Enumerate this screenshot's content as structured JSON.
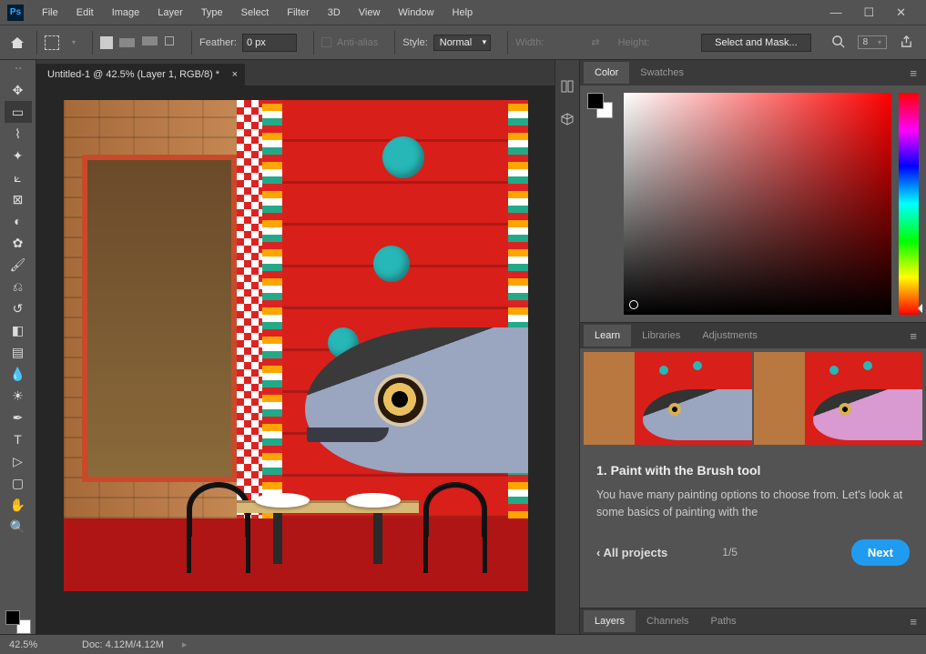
{
  "menu": {
    "items": [
      "File",
      "Edit",
      "Image",
      "Layer",
      "Type",
      "Select",
      "Filter",
      "3D",
      "View",
      "Window",
      "Help"
    ]
  },
  "options": {
    "feather_label": "Feather:",
    "feather_value": "0 px",
    "antialias": "Anti-alias",
    "style_label": "Style:",
    "style_value": "Normal",
    "width_label": "Width:",
    "height_label": "Height:",
    "select_mask": "Select and Mask...",
    "workspace_num": "8"
  },
  "document": {
    "tab_title": "Untitled-1 @ 42.5% (Layer 1, RGB/8) *",
    "zoom": "42.5%",
    "doc_size": "Doc: 4.12M/4.12M"
  },
  "panels": {
    "color_tabs": [
      "Color",
      "Swatches"
    ],
    "learn_tabs": [
      "Learn",
      "Libraries",
      "Adjustments"
    ],
    "bottom_tabs": [
      "Layers",
      "Channels",
      "Paths"
    ]
  },
  "learn": {
    "step_title": "1.  Paint with the Brush tool",
    "step_desc": "You have many painting options to choose from. Let's look at some basics of painting with the",
    "back": "‹  All projects",
    "page": "1/5",
    "next": "Next"
  },
  "tools": [
    "move-tool",
    "marquee-tool",
    "lasso-tool",
    "quick-select-tool",
    "crop-tool",
    "frame-tool",
    "eyedropper-tool",
    "healing-brush-tool",
    "brush-tool",
    "clone-stamp-tool",
    "history-brush-tool",
    "eraser-tool",
    "gradient-tool",
    "blur-tool",
    "dodge-tool",
    "pen-tool",
    "type-tool",
    "path-select-tool",
    "rectangle-tool",
    "hand-tool",
    "zoom-tool"
  ],
  "tool_glyphs": [
    "✥",
    "▭",
    "⌇",
    "✦",
    "⟀",
    "⊠",
    "◐",
    "✿",
    "🖌",
    "⎌",
    "↺",
    "◧",
    "▤",
    "💧",
    "☀",
    "✒",
    "T",
    "▷",
    "▢",
    "✋",
    "🔍"
  ]
}
